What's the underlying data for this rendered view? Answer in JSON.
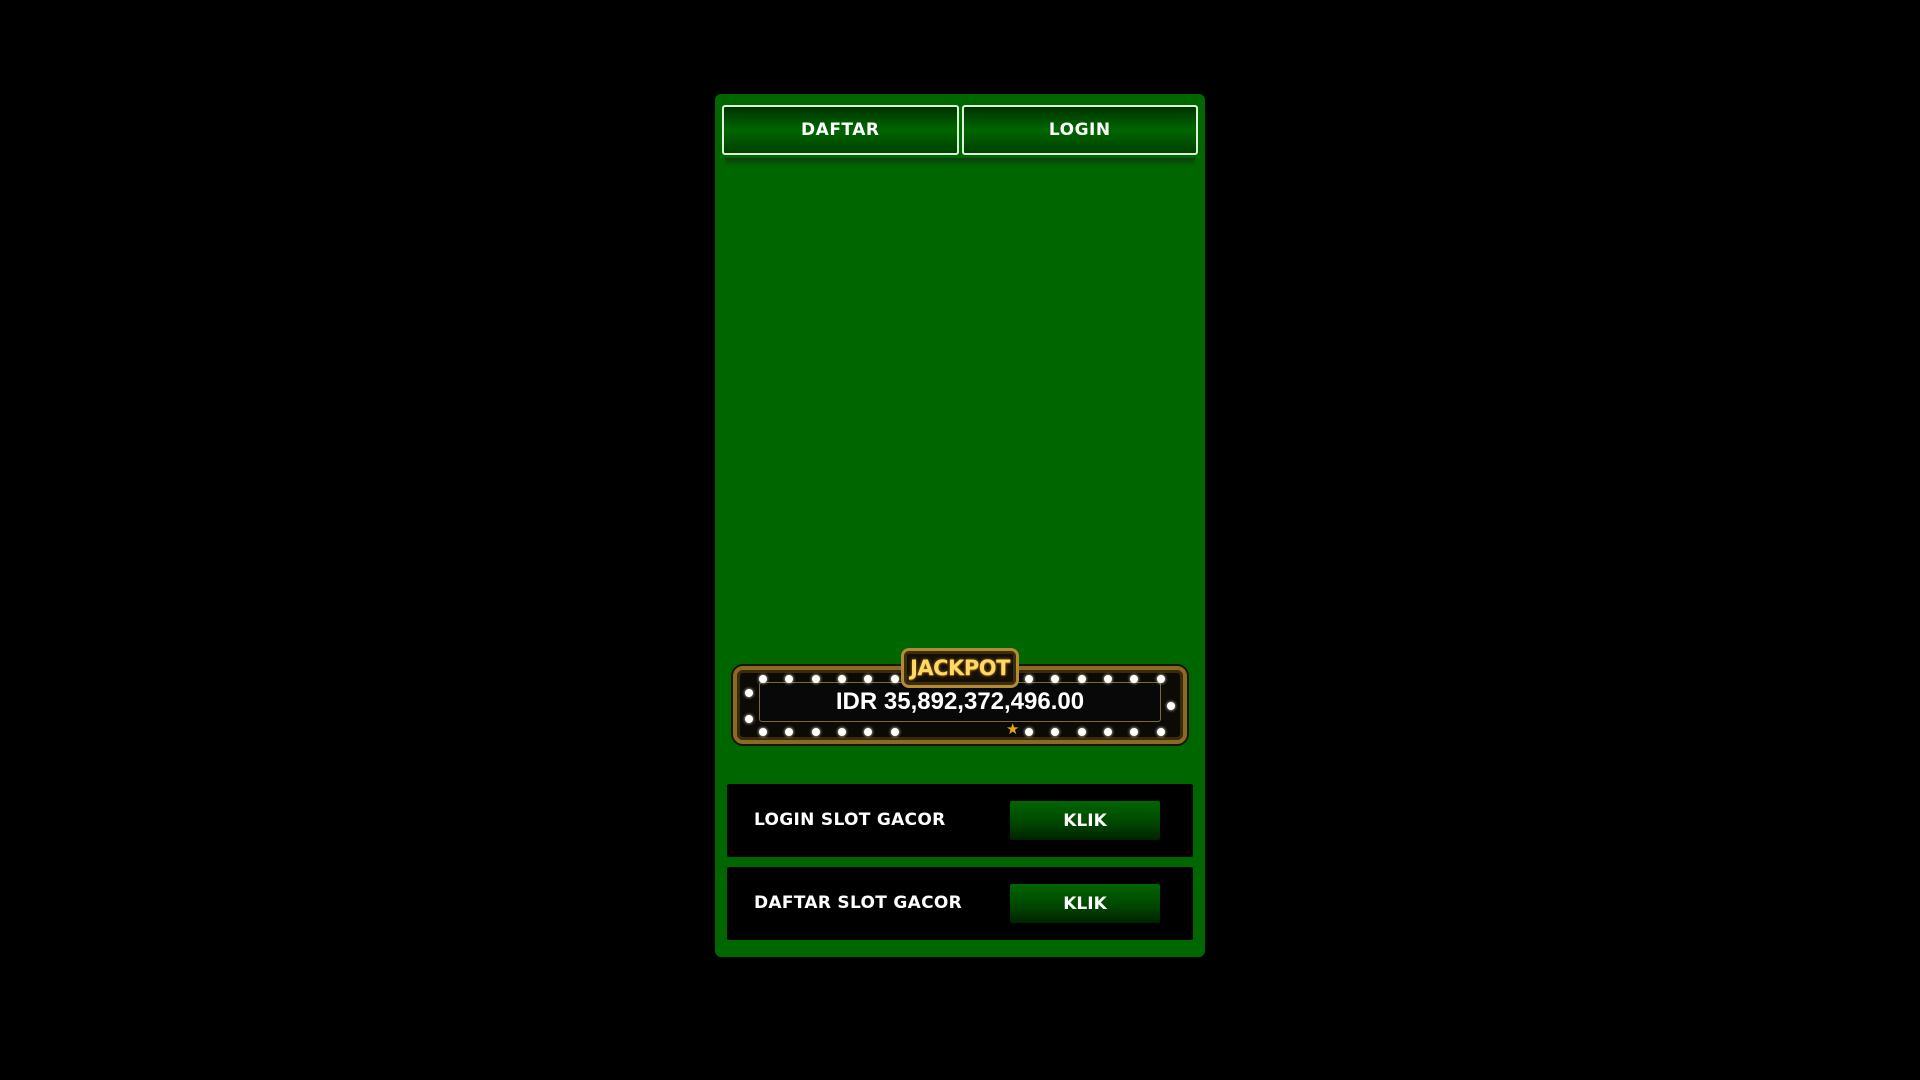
{
  "header": {
    "daftar_label": "DAFTAR",
    "login_label": "LOGIN"
  },
  "jackpot": {
    "title": "JACKPOT",
    "amount": "IDR 35,892,372,496.00"
  },
  "links": [
    {
      "label": "LOGIN SLOT GACOR",
      "button": "KLIK"
    },
    {
      "label": "DAFTAR SLOT GACOR",
      "button": "KLIK"
    }
  ],
  "colors": {
    "background": "#000000",
    "panel": "#006600",
    "button_dark": "#003300",
    "jackpot_gold": "#ffd966"
  },
  "icons": {
    "star": "star-icon"
  }
}
